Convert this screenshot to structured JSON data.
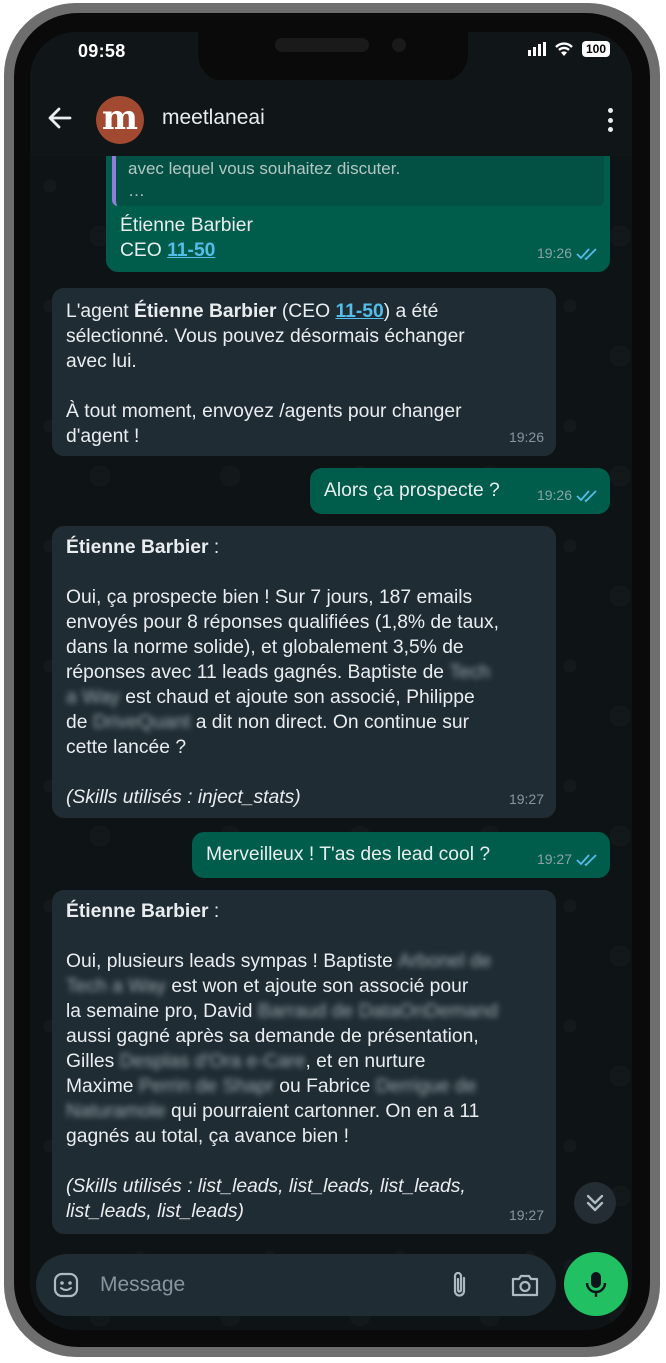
{
  "status": {
    "time": "09:58",
    "battery": "100"
  },
  "header": {
    "avatar_letter": "m",
    "contact_name": "meetlaneai"
  },
  "messages": {
    "m1": {
      "quote_text": "avec lequel vous souhaitez discuter.",
      "quote_more": "…",
      "line1": "Étienne Barbier",
      "line2_prefix": "CEO ",
      "line2_link": "11-50",
      "time": "19:26"
    },
    "m2": {
      "l1_a": "L'agent ",
      "l1_bold": "Étienne Barbier",
      "l1_b": " (CEO ",
      "l1_link": "11-50",
      "l1_c": ") a été",
      "l2": "sélectionné. Vous pouvez désormais échanger",
      "l3": "avec lui.",
      "l5": "À tout moment, envoyez /agents pour changer",
      "l6": "d'agent !",
      "time": "19:26"
    },
    "m3": {
      "text": "Alors ça prospecte ?",
      "time": "19:26"
    },
    "m4": {
      "sender": "Étienne Barbier",
      "sender_suffix": " :",
      "l1": "Oui, ça prospecte bien ! Sur 7 jours, 187 emails",
      "l2": "envoyés pour 8 réponses qualifiées (1,8% de taux,",
      "l3": "dans la norme solide), et globalement 3,5% de",
      "l4": "réponses avec 11 leads gagnés. Baptiste de",
      "l4_blur": "Tech",
      "l5_blur": "a Way",
      "l5": "est chaud et ajoute son associé, Philippe",
      "l6_a": "de",
      "l6_blur": "DriveQuant",
      "l6_b": "a dit non direct. On continue sur",
      "l7": "cette lancée ?",
      "skills": "(Skills utilisés : inject_stats)",
      "time": "19:27"
    },
    "m5": {
      "text": "Merveilleux ! T'as des lead cool ?",
      "time": "19:27"
    },
    "m6": {
      "sender": "Étienne Barbier",
      "sender_suffix": " :",
      "l1": "Oui, plusieurs leads sympas ! Baptiste",
      "l1_blur": "Arbonel de",
      "l2_blur": "Tech a Way",
      "l2": "est won et ajoute son associé pour",
      "l3": "la semaine pro, David",
      "l3_blur": "Barraud de DataOnDemand",
      "l4": "aussi gagné après sa demande de présentation,",
      "l5_a": "Gilles",
      "l5_blur": "Desplas d'Ora e-Care",
      "l5_b": ", et en nurture",
      "l6_a": "Maxime",
      "l6_blur": "Perrin de Shapr",
      "l6_b": "ou Fabrice",
      "l6_blur2": "Derrigue de",
      "l7_blur": "Naturamole",
      "l7": "qui pourraient cartonner. On en a 11",
      "l8": "gagnés au total, ça avance bien !",
      "skills1": "(Skills utilisés : list_leads, list_leads, list_leads,",
      "skills2": "list_leads, list_leads)",
      "time": "19:27"
    }
  },
  "input": {
    "placeholder": "Message"
  },
  "colors": {
    "incoming": "#202c33",
    "outgoing": "#005c4b",
    "accent": "#21c063",
    "link": "#53bdeb",
    "tick": "#53bdeb"
  },
  "icons": [
    "back-arrow-icon",
    "kebab-menu-icon",
    "double-check-icon",
    "emoji-icon",
    "paperclip-icon",
    "camera-icon",
    "microphone-icon",
    "chevron-double-down-icon",
    "wifi-icon",
    "signal-icon",
    "battery-icon"
  ]
}
